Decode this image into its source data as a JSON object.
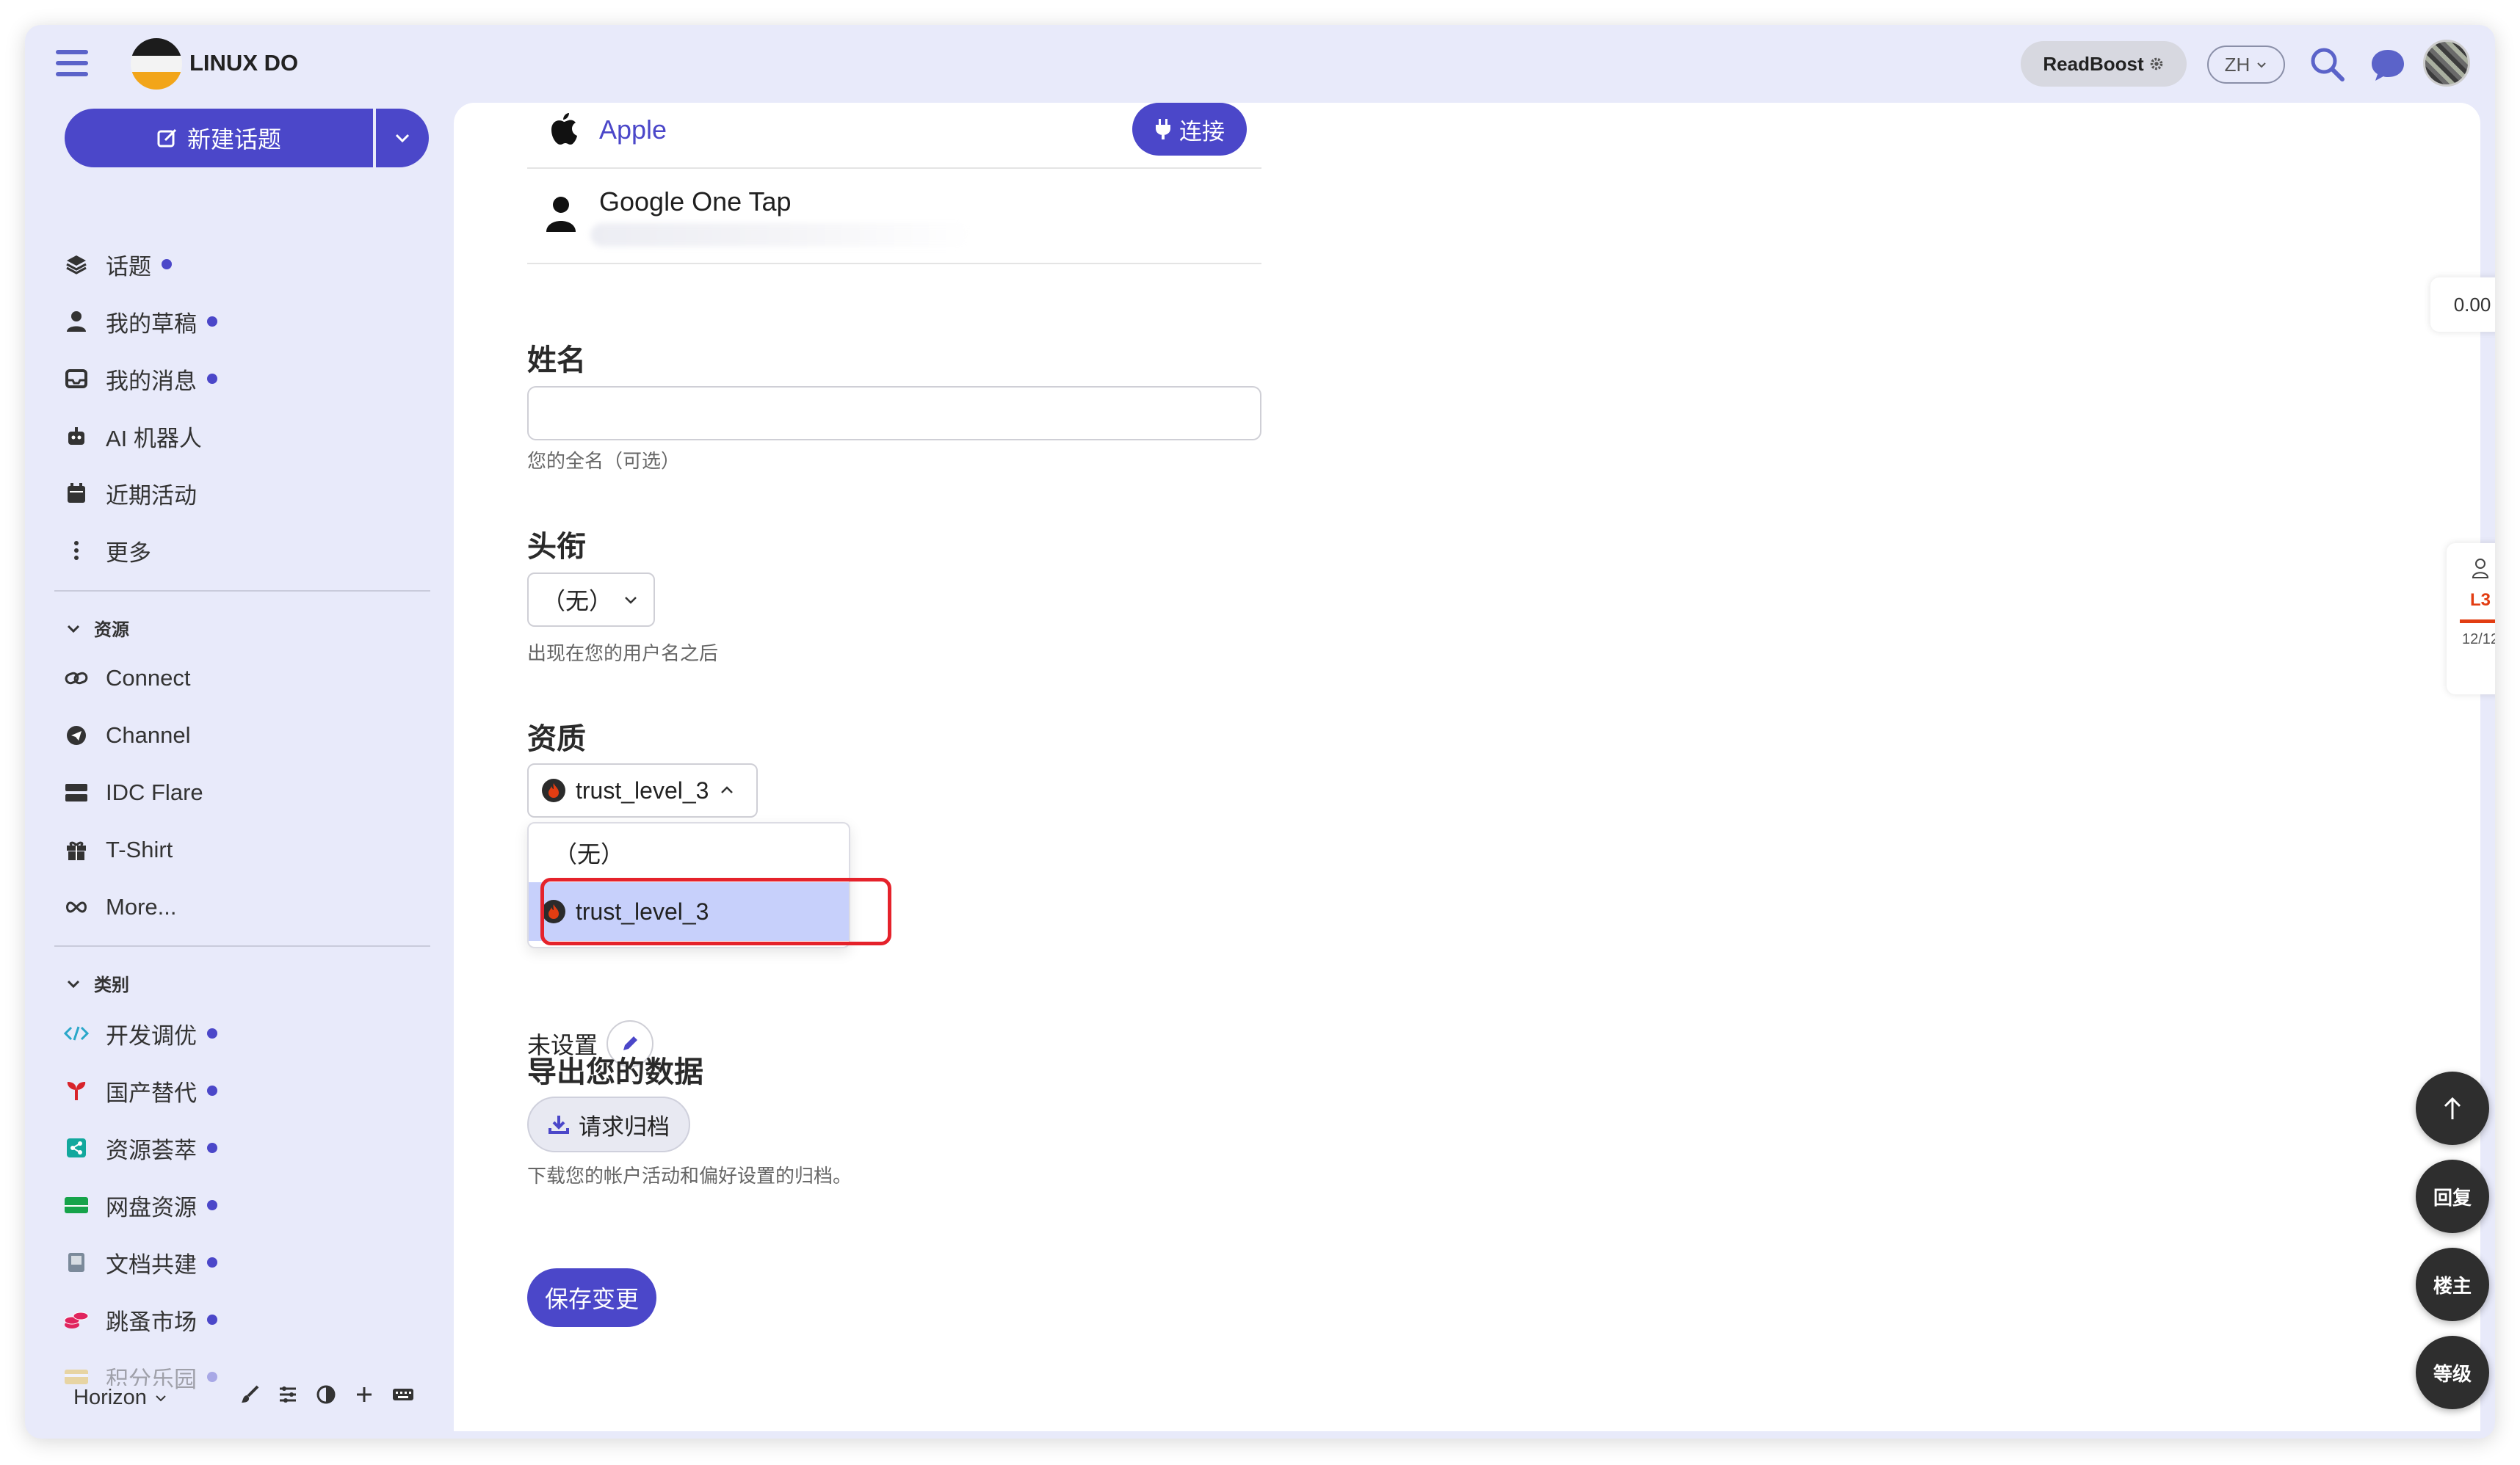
{
  "header": {
    "site_title": "LINUX DO",
    "readboost_label": "ReadBoost",
    "lang_label": "ZH"
  },
  "sidebar": {
    "new_topic_label": "新建话题",
    "nav_items": [
      {
        "label": "话题",
        "icon": "layers-icon",
        "dot": true
      },
      {
        "label": "我的草稿",
        "icon": "user-icon",
        "dot": true
      },
      {
        "label": "我的消息",
        "icon": "inbox-icon",
        "dot": true
      },
      {
        "label": "AI 机器人",
        "icon": "robot-icon",
        "dot": false
      },
      {
        "label": "近期活动",
        "icon": "calendar-icon",
        "dot": false
      },
      {
        "label": "更多",
        "icon": "more-vertical-icon",
        "dot": false
      }
    ],
    "resources_header": "资源",
    "resource_items": [
      {
        "label": "Connect",
        "icon": "link-icon"
      },
      {
        "label": "Channel",
        "icon": "telegram-icon"
      },
      {
        "label": "IDC Flare",
        "icon": "server-icon"
      },
      {
        "label": "T-Shirt",
        "icon": "gift-icon"
      },
      {
        "label": "More...",
        "icon": "infinity-icon"
      }
    ],
    "categories_header": "类别",
    "category_items": [
      {
        "label": "开发调优",
        "color": "#2aa7c9"
      },
      {
        "label": "国产替代",
        "color": "#d8232a"
      },
      {
        "label": "资源荟萃",
        "color": "#12a89d"
      },
      {
        "label": "网盘资源",
        "color": "#16a34a"
      },
      {
        "label": "文档共建",
        "color": "#7b8a9a"
      },
      {
        "label": "跳蚤市场",
        "color": "#e0245e"
      },
      {
        "label": "积分乐园",
        "color": "#e6b422"
      }
    ],
    "theme_label": "Horizon"
  },
  "main": {
    "apple_label": "Apple",
    "connect_label": "连接",
    "google_label": "Google One Tap",
    "name_title": "姓名",
    "name_help": "您的全名（可选）",
    "title_title": "头衔",
    "title_select_value": "（无）",
    "title_help": "出现在您的用户名之后",
    "flair_title": "资质",
    "flair_select_value": "trust_level_3",
    "flair_options": [
      "（无）",
      "trust_level_3"
    ],
    "unset_label": "未设置",
    "export_title": "导出您的数据",
    "archive_label": "请求归档",
    "export_help": "下载您的帐户活动和偏好设置的归档。",
    "save_label": "保存变更"
  },
  "right": {
    "score_value": "0.00",
    "level_label": "L3",
    "level_progress": "12/12",
    "reply_label": "回复",
    "op_label": "楼主",
    "level_btn_label": "等级"
  },
  "colors": {
    "accent": "#4b47c9",
    "highlight": "#e5222b",
    "level": "#e23d12"
  }
}
